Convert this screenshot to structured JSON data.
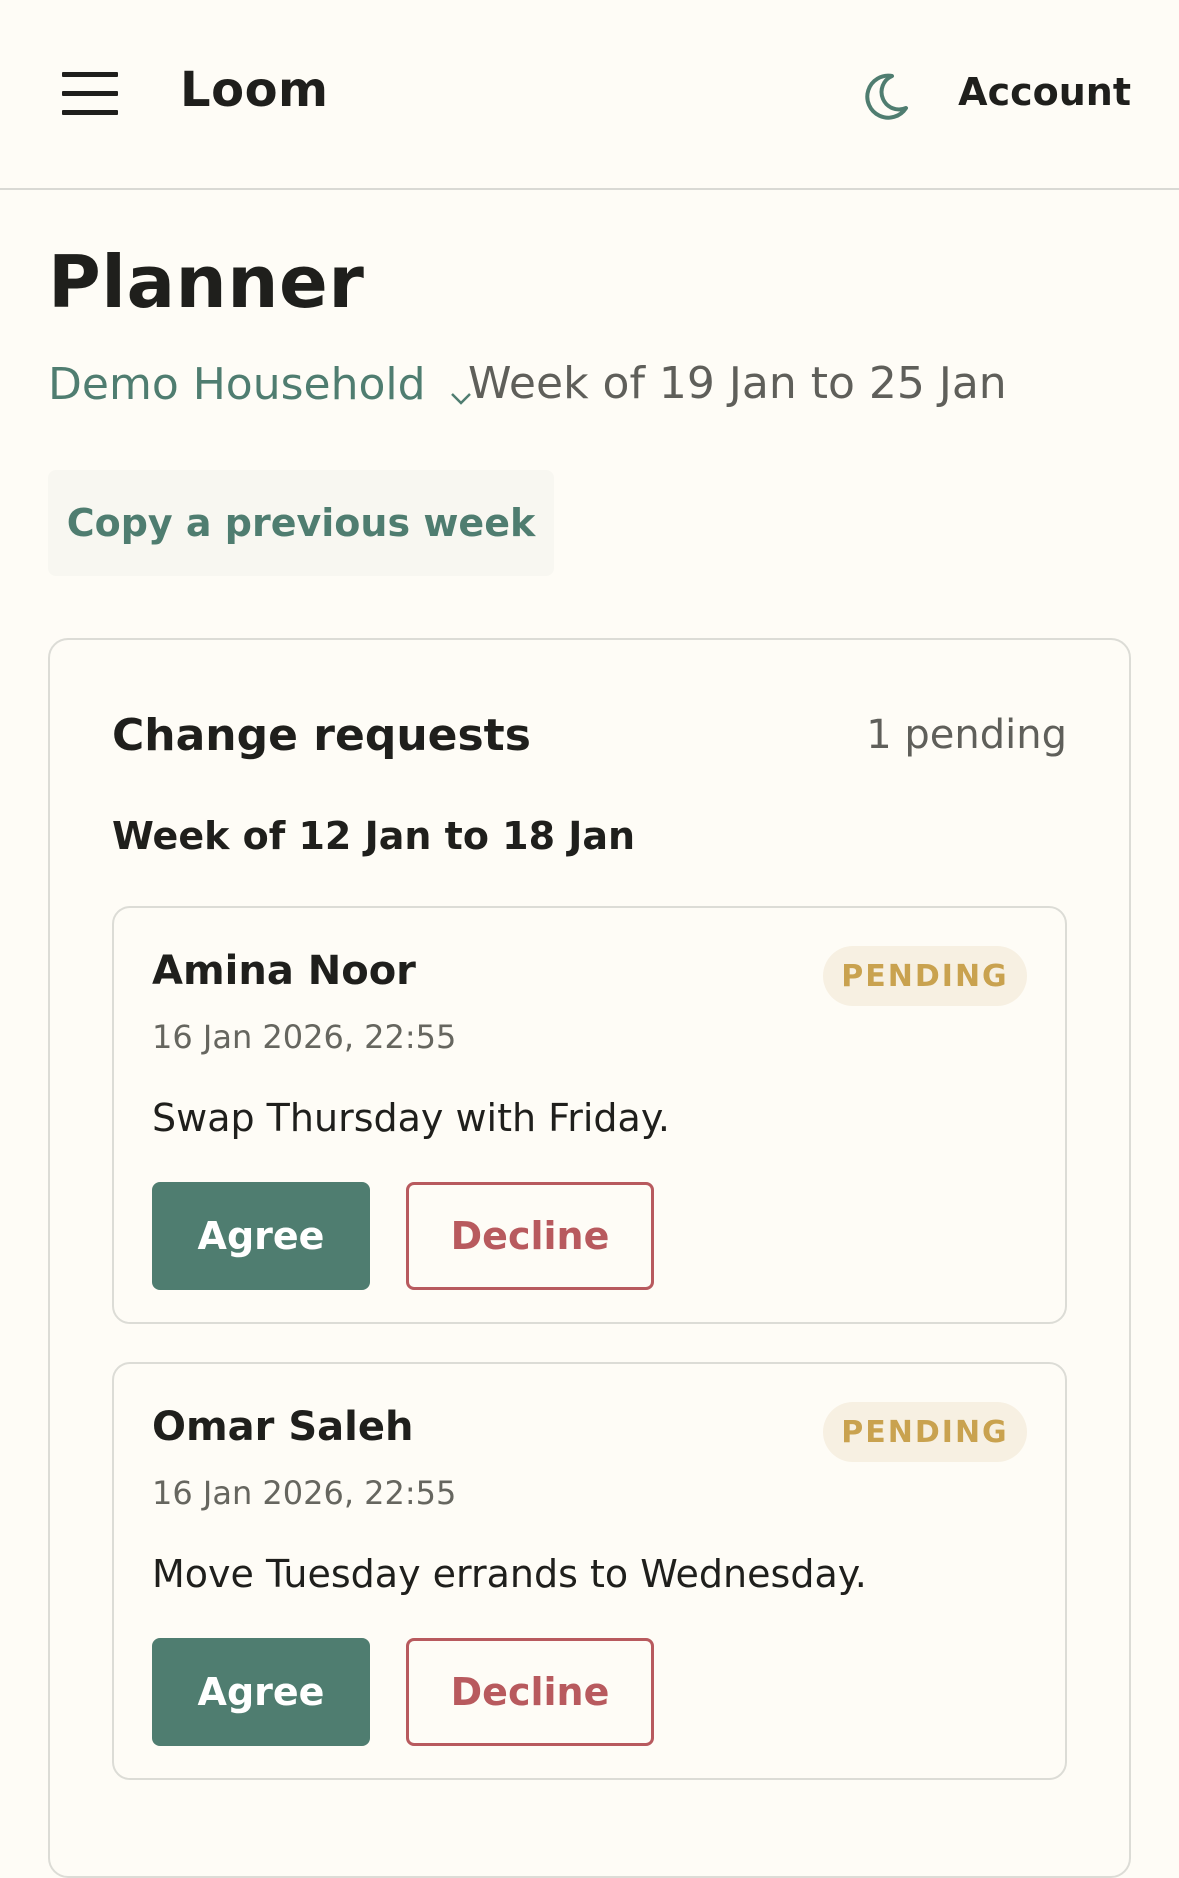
{
  "header": {
    "brand": "Loom",
    "menu_icon": "hamburger-menu-icon",
    "theme_icon": "moon-icon",
    "account_label": "Account"
  },
  "planner": {
    "title": "Planner",
    "household": "Demo Household",
    "week_range": "Week of 19 Jan to 25 Jan",
    "copy_week_label": "Copy a previous week"
  },
  "change_requests": {
    "title": "Change requests",
    "pending_count": "1 pending",
    "group_heading": "Week of 12 Jan to 18 Jan",
    "items": [
      {
        "name": "Amina Noor",
        "status": "PENDING",
        "timestamp": "16 Jan 2026, 22:55",
        "message": "Swap Thursday with Friday.",
        "agree_label": "Agree",
        "decline_label": "Decline"
      },
      {
        "name": "Omar Saleh",
        "status": "PENDING",
        "timestamp": "16 Jan 2026, 22:55",
        "message": "Move Tuesday errands to Wednesday.",
        "agree_label": "Agree",
        "decline_label": "Decline"
      }
    ]
  },
  "colors": {
    "background": "#fefcf6",
    "accent": "#4f7d70",
    "decline": "#b85a5e",
    "pending_badge_text": "#c9a24f",
    "pending_badge_bg": "#f7f0e2"
  }
}
